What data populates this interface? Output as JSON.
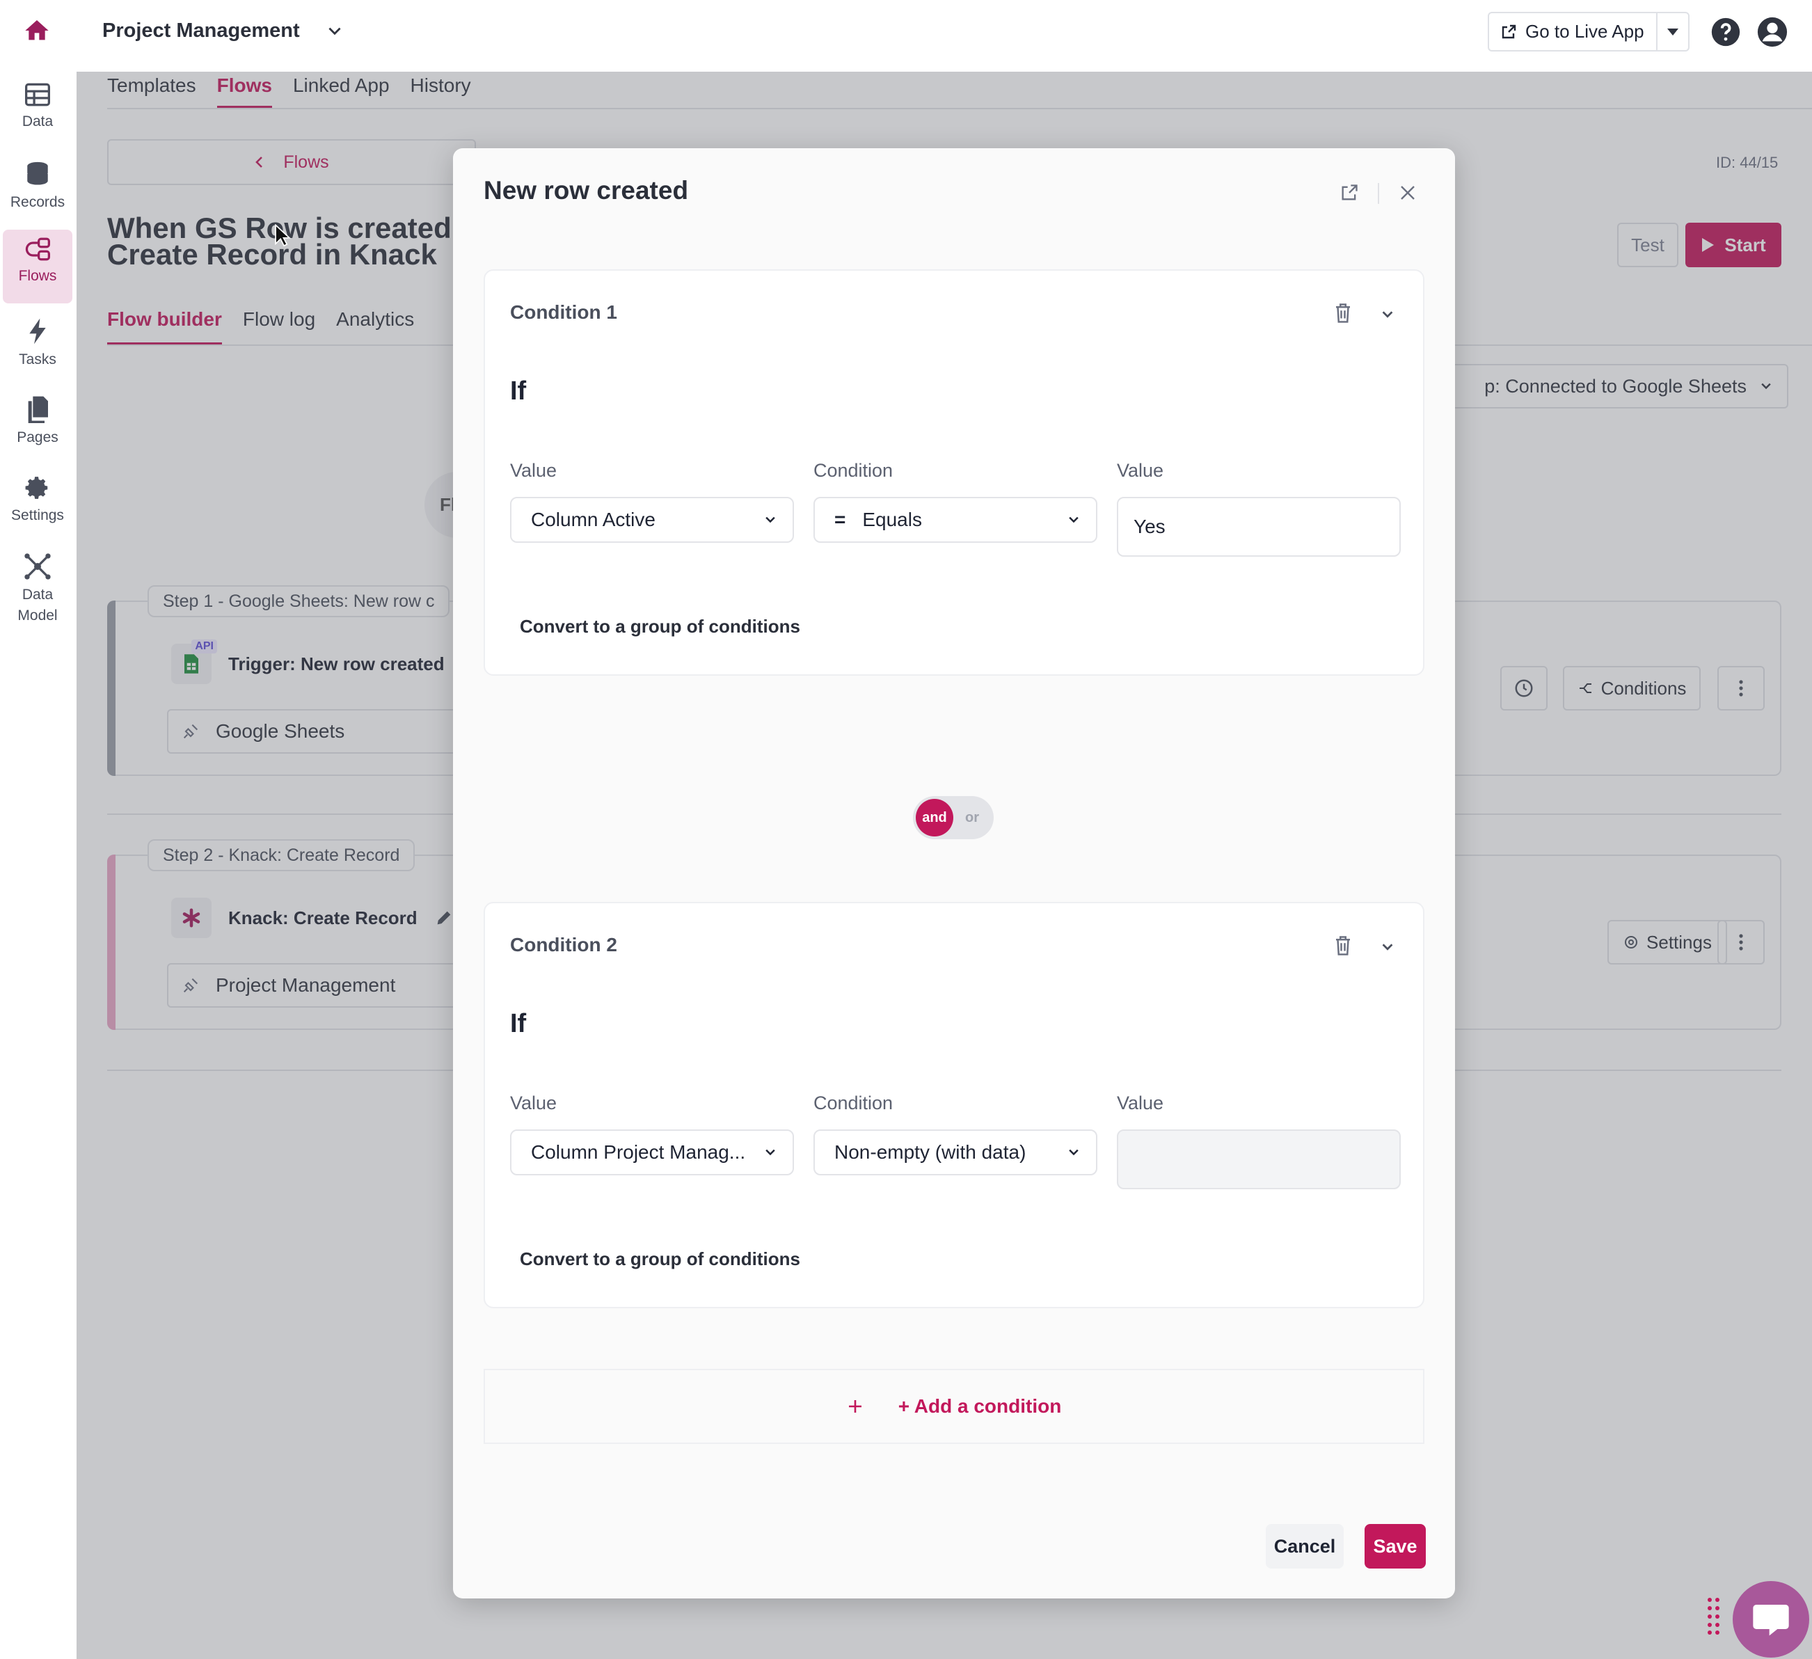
{
  "colors": {
    "accent": "#c2185b",
    "accent_soft": "#f2dbe8",
    "overlay": "#5c5e66"
  },
  "nav": {
    "items": [
      {
        "label": "Data",
        "icon": "table-icon"
      },
      {
        "label": "Records",
        "icon": "database-icon"
      },
      {
        "label": "Flows",
        "icon": "flows-icon",
        "active": true
      },
      {
        "label": "Tasks",
        "icon": "bolt-icon"
      },
      {
        "label": "Pages",
        "icon": "pages-icon"
      },
      {
        "label": "Settings",
        "icon": "gear-icon"
      },
      {
        "label": "Data Model",
        "icon": "graph-icon"
      }
    ]
  },
  "header": {
    "app_name": "Project Management",
    "live_app_label": "Go to Live App"
  },
  "page": {
    "tabs": [
      "Templates",
      "Flows",
      "Linked App",
      "History"
    ],
    "active_tab": "Flows",
    "back_label": "Flows",
    "flow_title_line1": "When GS Row is created",
    "flow_title_line2": "Create Record in Knack",
    "flow_id": "ID: 44/15",
    "test_label": "Test",
    "start_label": "Start",
    "builder_tabs": [
      "Flow builder",
      "Flow log",
      "Analytics"
    ],
    "active_builder_tab": "Flow builder",
    "app_select": "p: Connected to Google Sheets",
    "fl_text": "Fl",
    "steps": [
      {
        "label": "Step 1 - Google Sheets: New row c",
        "title": "Trigger: New row created",
        "badge": "API",
        "app": "Google Sheets",
        "action": "Conditions"
      },
      {
        "label": "Step 2 - Knack: Create Record",
        "title": "Knack: Create Record",
        "app": "Project Management",
        "action": "Settings"
      }
    ]
  },
  "modal": {
    "title": "New row created",
    "conditions": [
      {
        "title": "Condition 1",
        "if_label": "If",
        "value_label": "Value",
        "condition_label": "Condition",
        "value2_label": "Value",
        "value_select": "Column Active",
        "operator_symbol": "=",
        "operator": "Equals",
        "value_input": "Yes",
        "convert_label": "Convert to a group of conditions"
      },
      {
        "title": "Condition 2",
        "if_label": "If",
        "value_label": "Value",
        "condition_label": "Condition",
        "value2_label": "Value",
        "value_select": "Column Project Manag...",
        "operator": "Non-empty (with data)",
        "value_input": "",
        "convert_label": "Convert to a group of conditions"
      }
    ],
    "logic": {
      "and": "and",
      "or": "or",
      "selected": "and"
    },
    "add_condition": "+ Add a condition",
    "cancel": "Cancel",
    "save": "Save"
  }
}
